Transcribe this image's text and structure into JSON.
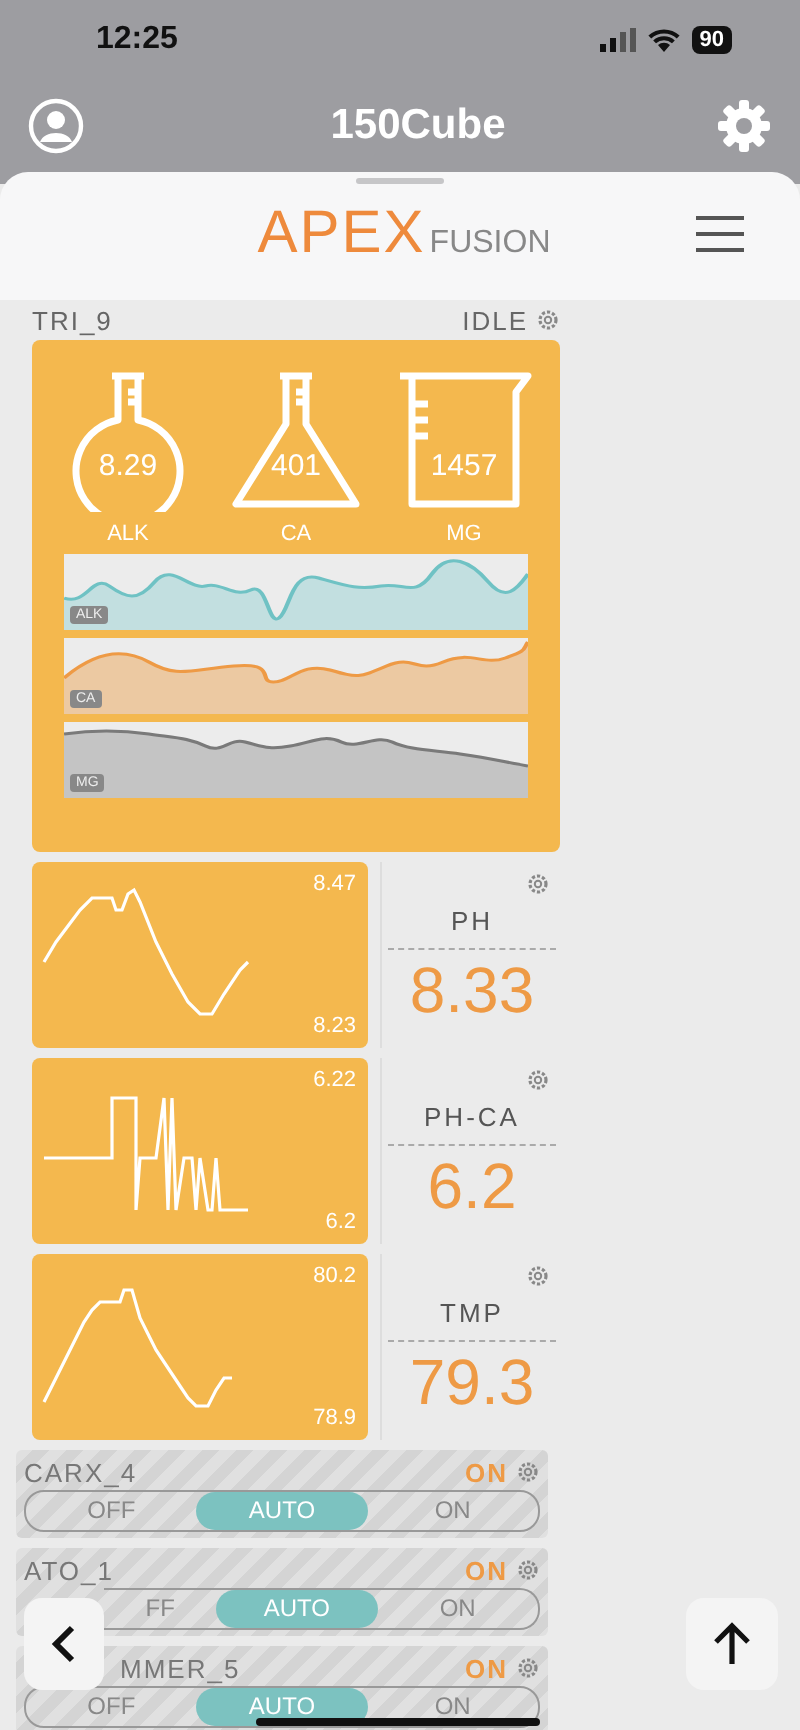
{
  "status_bar": {
    "time": "12:25",
    "battery": "90"
  },
  "header": {
    "title": "150Cube"
  },
  "logo": {
    "brand": "APEX",
    "suffix": "FUSION"
  },
  "trident": {
    "name": "TRI_9",
    "state": "IDLE",
    "vessels": [
      {
        "kind": "round",
        "value": "8.29",
        "label": "ALK"
      },
      {
        "kind": "conical",
        "value": "401",
        "label": "CA"
      },
      {
        "kind": "beaker",
        "value": "1457",
        "label": "MG"
      }
    ],
    "graphs": [
      {
        "kind": "alk",
        "label": "ALK"
      },
      {
        "kind": "ca",
        "label": "CA"
      },
      {
        "kind": "mg",
        "label": "MG"
      }
    ]
  },
  "probes": [
    {
      "kind": "ramp",
      "max": "8.47",
      "min": "8.23",
      "name": "PH",
      "value": "8.33"
    },
    {
      "kind": "square",
      "max": "6.22",
      "min": "6.2",
      "name": "PH-CA",
      "value": "6.2"
    },
    {
      "kind": "steps",
      "max": "80.2",
      "min": "78.9",
      "name": "TMP",
      "value": "79.3"
    }
  ],
  "outlets": [
    {
      "name": "CARX_4",
      "state": "ON",
      "options": [
        {
          "label": "OFF",
          "selected": false
        },
        {
          "label": "AUTO",
          "selected": true
        },
        {
          "label": "ON",
          "selected": false
        }
      ]
    },
    {
      "name": "ATO_1",
      "state": "ON",
      "options": [
        {
          "label": "FF",
          "selected": false
        },
        {
          "label": "AUTO",
          "selected": true
        },
        {
          "label": "ON",
          "selected": false
        }
      ]
    },
    {
      "name": "MMER_5",
      "state": "ON",
      "options": [
        {
          "label": "OFF",
          "selected": false
        },
        {
          "label": "AUTO",
          "selected": true
        },
        {
          "label": "ON",
          "selected": false
        }
      ]
    }
  ]
}
